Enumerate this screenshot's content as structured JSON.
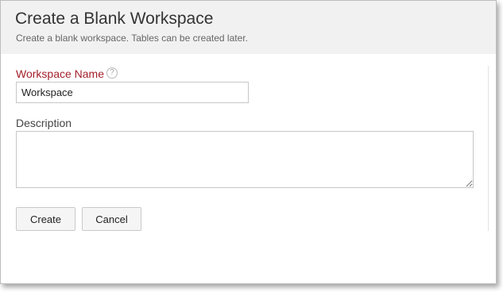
{
  "dialog": {
    "title": "Create a Blank Workspace",
    "subtitle": "Create a blank workspace. Tables can be created later."
  },
  "form": {
    "workspace_name": {
      "label": "Workspace Name",
      "help_icon": "?",
      "value": "Workspace"
    },
    "description": {
      "label": "Description",
      "value": ""
    }
  },
  "actions": {
    "create_label": "Create",
    "cancel_label": "Cancel"
  },
  "colors": {
    "header_bg": "#f1f1f1",
    "required_label": "#a31f2a"
  },
  "icons": {
    "help": "question-circle-icon"
  }
}
